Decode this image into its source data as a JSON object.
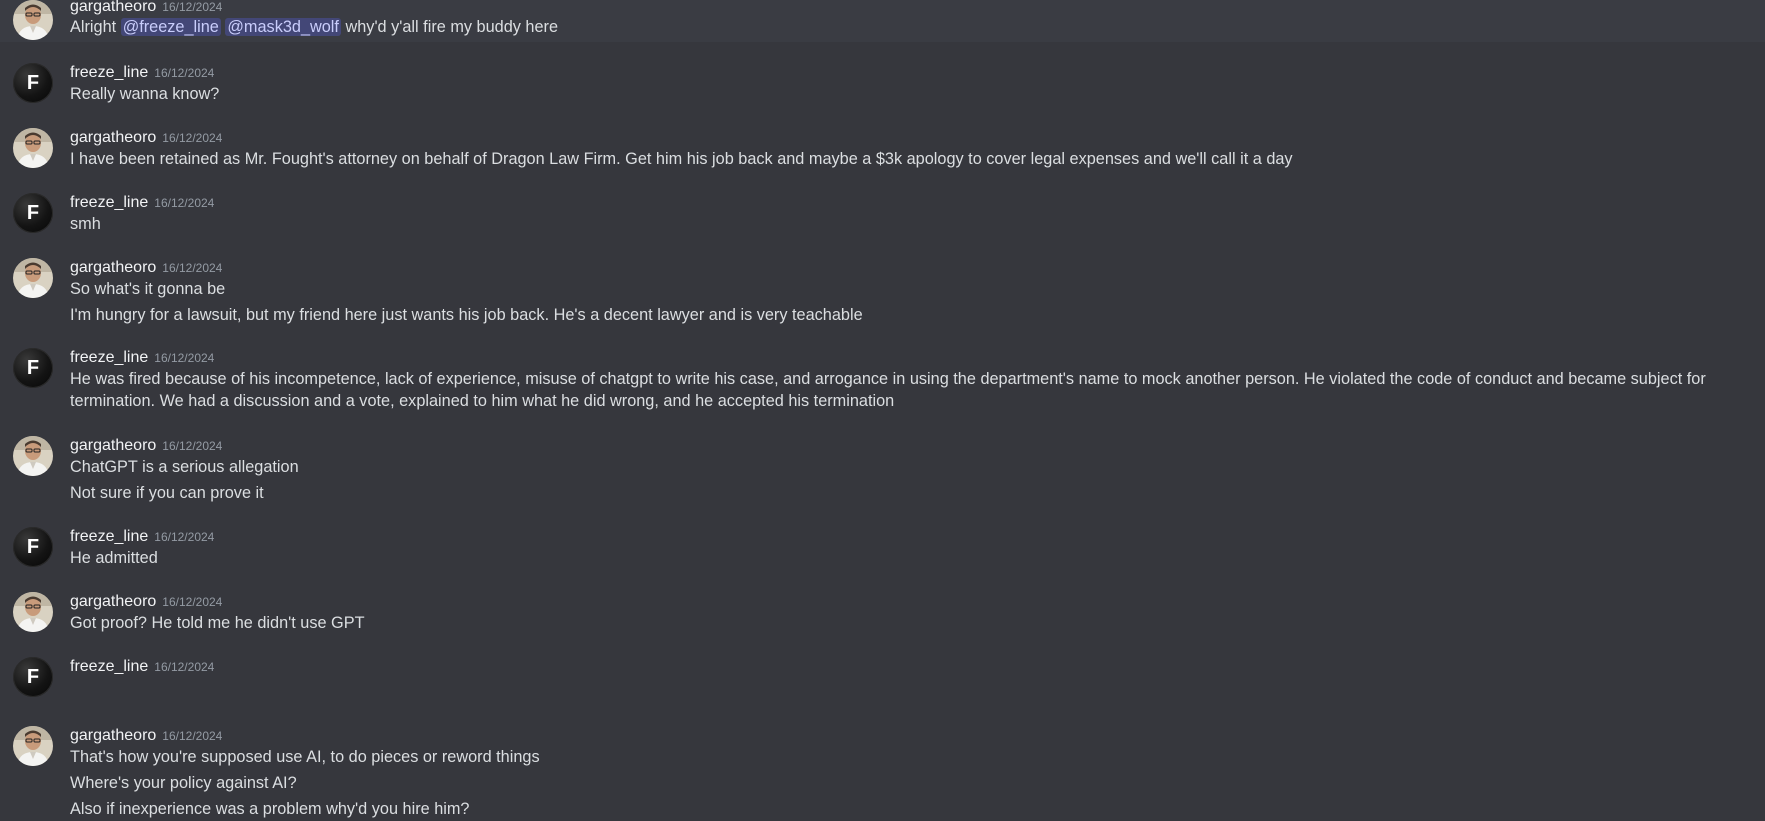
{
  "users": {
    "gargatheoro": {
      "name": "gargatheoro",
      "avatar": "portrait-photo"
    },
    "freeze_line": {
      "name": "freeze_line",
      "avatar_letter": "F"
    }
  },
  "messages": [
    {
      "author": "gargatheoro",
      "timestamp": "16/12/2024",
      "line1_prefix": "Alright",
      "mention1": "@freeze_line",
      "mention2": "@mask3d_wolf",
      "line1_suffix": "why'd y'all fire my buddy here"
    },
    {
      "author": "freeze_line",
      "timestamp": "16/12/2024",
      "lines": [
        "Really wanna know?"
      ]
    },
    {
      "author": "gargatheoro",
      "timestamp": "16/12/2024",
      "lines": [
        "I have been retained as Mr. Fought's attorney on behalf of Dragon Law Firm. Get him his job back and maybe a $3k apology to cover legal expenses and we'll call it a day"
      ]
    },
    {
      "author": "freeze_line",
      "timestamp": "16/12/2024",
      "lines": [
        "smh"
      ]
    },
    {
      "author": "gargatheoro",
      "timestamp": "16/12/2024",
      "lines": [
        "So what's it gonna be",
        "I'm hungry for a lawsuit, but my friend here just wants his job back. He's a decent lawyer and is very teachable"
      ]
    },
    {
      "author": "freeze_line",
      "timestamp": "16/12/2024",
      "lines": [
        "He was fired because of his incompetence, lack of experience, misuse of chatgpt to write his case, and arrogance in using the department's name to mock another person. He violated the code of conduct and became subject for termination. We had a discussion and a vote, explained to him what he did wrong, and he accepted his termination"
      ]
    },
    {
      "author": "gargatheoro",
      "timestamp": "16/12/2024",
      "lines": [
        "ChatGPT is a serious allegation",
        "Not sure if you can prove it"
      ]
    },
    {
      "author": "freeze_line",
      "timestamp": "16/12/2024",
      "lines": [
        "He admitted"
      ]
    },
    {
      "author": "gargatheoro",
      "timestamp": "16/12/2024",
      "lines": [
        "Got proof? He told me he didn't use GPT"
      ]
    },
    {
      "author": "freeze_line",
      "timestamp": "16/12/2024",
      "lines": []
    },
    {
      "author": "gargatheoro",
      "timestamp": "16/12/2024",
      "lines": [
        "That's how you're supposed use AI, to do pieces or reword things",
        "Where's your policy against AI?",
        "Also if inexperience was a problem why'd you hire him?"
      ]
    }
  ]
}
